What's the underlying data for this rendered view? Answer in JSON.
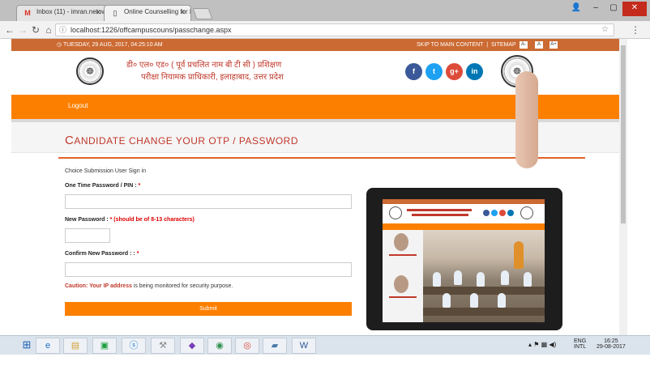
{
  "browser": {
    "tabs": [
      {
        "label": "Inbox (11) - imran.netow",
        "icon": "gmail-icon"
      },
      {
        "label": "Online Counselling for D",
        "icon": "page-icon"
      }
    ],
    "url": "localhost:1226/offcampuscouns/passchange.aspx"
  },
  "site": {
    "date": "TUESDAY, 29 AUG, 2017, 04:25:10 AM",
    "skip_link": "SKIP TO MAIN CONTENT",
    "sitemap": "SITEMAP",
    "font_sizes": [
      "A-",
      "A",
      "A+"
    ],
    "header_line1": "डी० एल० एड० ( पूर्व प्रचलित नाम बी टी सी ) प्रशिक्षण",
    "header_line2": "परीक्षा नियामक प्राधिकारी, इलाहाबाद, उत्तर प्रदेश",
    "social": [
      {
        "label": "f",
        "color": "#3b5998",
        "icon": "facebook-icon"
      },
      {
        "label": "t",
        "color": "#1da1f2",
        "icon": "twitter-icon"
      },
      {
        "label": "g+",
        "color": "#dd4b39",
        "icon": "google-plus-icon"
      },
      {
        "label": "in",
        "color": "#0077b5",
        "icon": "linkedin-icon"
      }
    ],
    "logout": "Logout"
  },
  "page": {
    "title_first": "C",
    "title_rest": "ANDIDATE CHANGE YOUR OTP / PASSWORD"
  },
  "form": {
    "heading": "Choice Submission User Sign in",
    "otp_label": "One Time Password / PIN : ",
    "new_password_label": "New Password : ",
    "new_password_hint": "* (should be of 8-13 characters)",
    "confirm_label": "Confirm New Password : : ",
    "required_mark": "*",
    "caution_strong": "Caution: Your IP address",
    "caution_rest": " is being monitored for security purpose.",
    "submit_label": "Submit"
  },
  "taskbar": {
    "language": "ENG",
    "region": "INTL",
    "time": "16:25",
    "date": "29-08-2017"
  }
}
